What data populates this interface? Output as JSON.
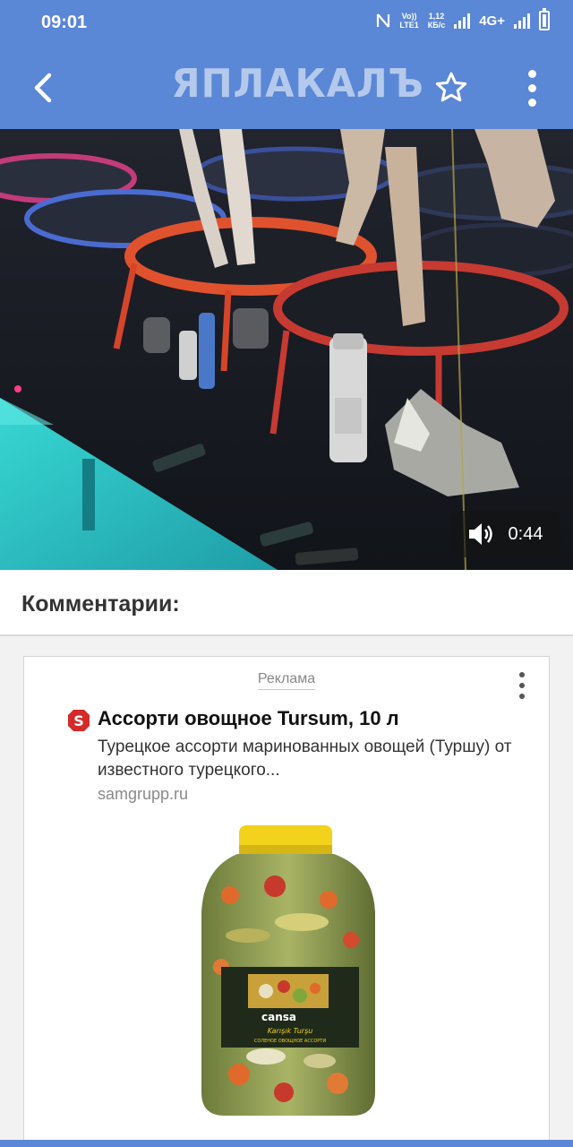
{
  "status_bar": {
    "time": "09:01",
    "volte_top": "Vo))",
    "volte_bottom": "LTE1",
    "speed_top": "1,12",
    "speed_bottom": "КБ/с",
    "network": "4G+"
  },
  "app_bar": {
    "logo_text": "ЯПЛАКАЛЪ",
    "icons": [
      "back-arrow-icon",
      "star-icon",
      "more-vert-icon"
    ]
  },
  "video": {
    "duration": "0:44",
    "icons": [
      "volume-icon"
    ]
  },
  "comments": {
    "title": "Комментарии:"
  },
  "ad": {
    "label": "Реклама",
    "title": "Ассорти овощное Tursum, 10 л",
    "description": "Турецкое ассорти маринованных овощей (Туршу) от известного турецкого...",
    "domain": "samgrupp.ru",
    "product_brand": "cansa",
    "product_name": "Karışık Turşu",
    "product_subtitle": "СОЛЕНОЕ ОВОЩНОЕ АССОРТИ",
    "colors": {
      "logo_red": "#d42a2a",
      "lid_yellow": "#f2d21b"
    }
  },
  "theme": {
    "primary": "#5a87d6"
  }
}
